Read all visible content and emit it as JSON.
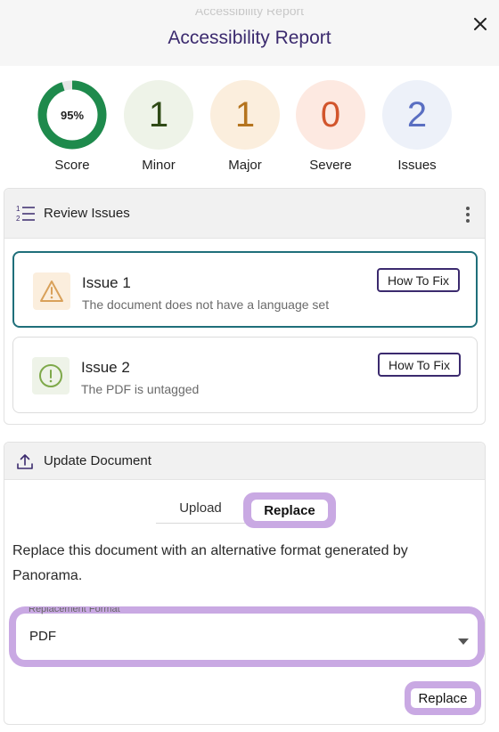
{
  "header": {
    "ghost_text": "Accessibility Report",
    "title": "Accessibility Report",
    "close_icon": "close-icon"
  },
  "stats": {
    "score": {
      "value": "95%",
      "label": "Score",
      "fraction": 0.95,
      "color": "#1e8a4c"
    },
    "minor": {
      "value": "1",
      "label": "Minor",
      "bg": "#eef3e8",
      "color": "#2f4a16"
    },
    "major": {
      "value": "1",
      "label": "Major",
      "bg": "#fbeedd",
      "color": "#b5741e"
    },
    "severe": {
      "value": "0",
      "label": "Severe",
      "bg": "#fde9e1",
      "color": "#d2552c"
    },
    "issues": {
      "value": "2",
      "label": "Issues",
      "bg": "#edf1f9",
      "color": "#5a6fc2"
    }
  },
  "review": {
    "title": "Review Issues",
    "icon": "numbered-list-icon",
    "menu_icon": "kebab-menu-icon",
    "issues": [
      {
        "title": "Issue 1",
        "desc": "The document does not have a language set",
        "fix_label": "How To Fix",
        "icon": "warning-triangle-icon",
        "icon_bg": "#fbeedd",
        "icon_color": "#d9a15a"
      },
      {
        "title": "Issue 2",
        "desc": "The PDF is untagged",
        "fix_label": "How To Fix",
        "icon": "info-exclamation-icon",
        "icon_bg": "#eef3e8",
        "icon_color": "#7ea94a"
      }
    ]
  },
  "update": {
    "title": "Update Document",
    "icon": "upload-icon",
    "tabs": {
      "upload": "Upload",
      "replace": "Replace"
    },
    "description": "Replace this document with an alternative format generated by Panorama.",
    "select": {
      "label": "Replacement Format",
      "value": "PDF"
    },
    "submit_label": "Replace"
  },
  "colors": {
    "accent": "#3b2a6e",
    "highlight": "#c9a9e3",
    "active_border": "#1f6f7a"
  }
}
